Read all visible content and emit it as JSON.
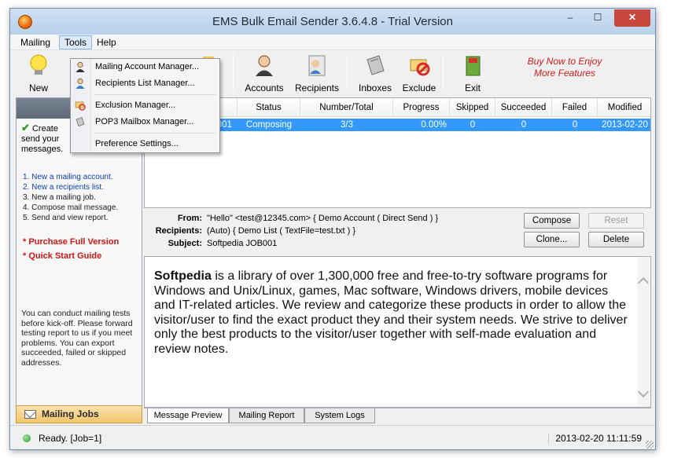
{
  "window": {
    "title": "EMS Bulk Email Sender 3.6.4.8 - Trial Version"
  },
  "window_controls": {
    "minimize": "–",
    "maximize": "☐",
    "close": "✕"
  },
  "menubar": {
    "items": [
      "Mailing",
      "Tools",
      "Help"
    ]
  },
  "tools_menu": {
    "items": [
      {
        "label": "Mailing Account Manager...",
        "icon": "account-manager-icon"
      },
      {
        "label": "Recipients List Manager...",
        "icon": "recipients-manager-icon"
      },
      {
        "label": "Exclusion Manager...",
        "icon": "exclusion-icon"
      },
      {
        "label": "POP3 Mailbox Manager...",
        "icon": "pop3-icon"
      },
      {
        "label": "Preference Settings...",
        "icon": ""
      }
    ]
  },
  "toolbar": {
    "new": "New",
    "import": "port",
    "accounts": "Accounts",
    "recipients": "Recipients",
    "inboxes": "Inboxes",
    "exclude": "Exclude",
    "exit": "Exit",
    "promo_line1": "Buy Now to Enjoy",
    "promo_line2": "More Features"
  },
  "sidebar": {
    "header": "Ma",
    "intro_line1": "Create",
    "intro_line2": "send your",
    "intro_line3": "messages.",
    "steps": [
      "1. New a mailing account.",
      "2. New a recipients list.",
      "3. New a mailing job.",
      "4. Compose mail message.",
      "5. Send and view report."
    ],
    "link_purchase": "* Purchase Full Version",
    "link_quickstart": "* Quick Start Guide",
    "note": "You can conduct mailing tests before kick-off. Please forward testing report to us if you meet problems. You can export succeeded, failed or skipped addresses.",
    "tab_label": "Mailing Jobs"
  },
  "grid": {
    "columns": [
      "Status",
      "Number/Total",
      "Progress",
      "Skipped",
      "Succeeded",
      "Failed",
      "Modified"
    ],
    "row": {
      "name": "B001",
      "status": "Composing",
      "number_total": "3/3",
      "progress": "0.00%",
      "skipped": "0",
      "succeeded": "0",
      "failed": "0",
      "modified": "2013-02-20"
    }
  },
  "details": {
    "from_label": "From:",
    "from_value": "\"Hello\" <test@12345.com> { Demo Account ( Direct Send ) }",
    "recipients_label": "Recipients:",
    "recipients_value": "(Auto) { Demo List ( TextFile=test.txt ) }",
    "subject_label": "Subject:",
    "subject_value": "Softpedia JOB001",
    "btn_compose": "Compose",
    "btn_reset": "Reset",
    "btn_clone": "Clone...",
    "btn_delete": "Delete"
  },
  "preview": {
    "bold": "Softpedia",
    "text": " is a library of over 1,300,000 free and free-to-try software programs for Windows and Unix/Linux, games, Mac software, Windows drivers, mobile devices and IT-related articles. We review and categorize these products in order to allow the visitor/user to find the exact product they and their system needs. We strive to deliver only the best products to the visitor/user together with self-made evaluation and review notes."
  },
  "tabs": [
    "Message Preview",
    "Mailing Report",
    "System Logs"
  ],
  "status": {
    "text": "Ready. [Job=1]",
    "time": "2013-02-20 11:11:59"
  },
  "colors": {
    "selection": "#3399ff",
    "promo": "#d11a1a",
    "link": "#0b3fb3"
  }
}
